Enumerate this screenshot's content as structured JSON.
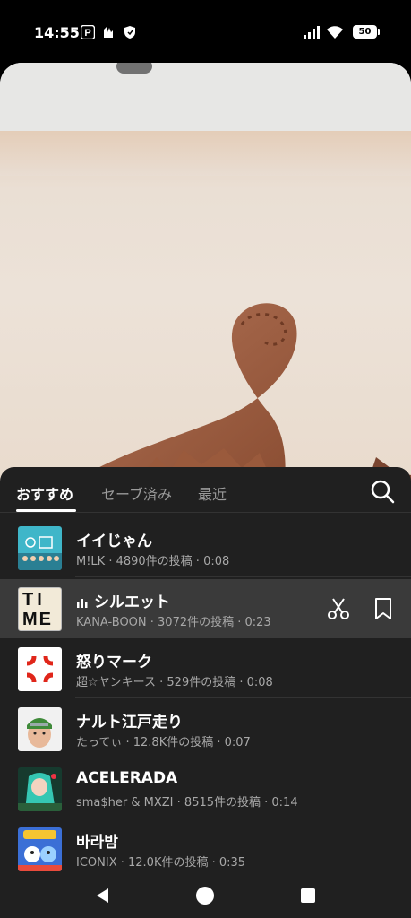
{
  "status_bar": {
    "time": "14:55",
    "battery": "50",
    "icons": [
      "p-app-icon",
      "hands-icon",
      "shield-icon",
      "signal-icon",
      "wifi-icon",
      "battery-icon"
    ]
  },
  "tabs": [
    {
      "label": "おすすめ",
      "active": true
    },
    {
      "label": "セーブ済み",
      "active": false
    },
    {
      "label": "最近",
      "active": false
    }
  ],
  "tracks": [
    {
      "title": "イイじゃん",
      "meta": "M!LK · 4890件の投稿 · 0:08",
      "selected": false
    },
    {
      "title": "シルエット",
      "meta": "KANA-BOON · 3072件の投稿 · 0:23",
      "selected": true,
      "thumb_text_top": "TI",
      "thumb_text_bottom": "ME"
    },
    {
      "title": "怒りマーク",
      "meta": "超☆ヤンキース · 529件の投稿 · 0:08",
      "selected": false
    },
    {
      "title": "ナルト江戸走り",
      "meta": "たってぃ · 12.8K件の投稿 · 0:07",
      "selected": false
    },
    {
      "title": "ACELERADA",
      "meta": "sma$her & MXZI · 8515件の投稿 · 0:14",
      "selected": false
    },
    {
      "title": "바라밤",
      "meta": "ICONIX · 12.0K件の投稿 · 0:35",
      "selected": false
    }
  ],
  "colors": {
    "sheet_bg": "#202020",
    "selected_row": "#3a3a3a",
    "accent_red": "#e0261a"
  }
}
